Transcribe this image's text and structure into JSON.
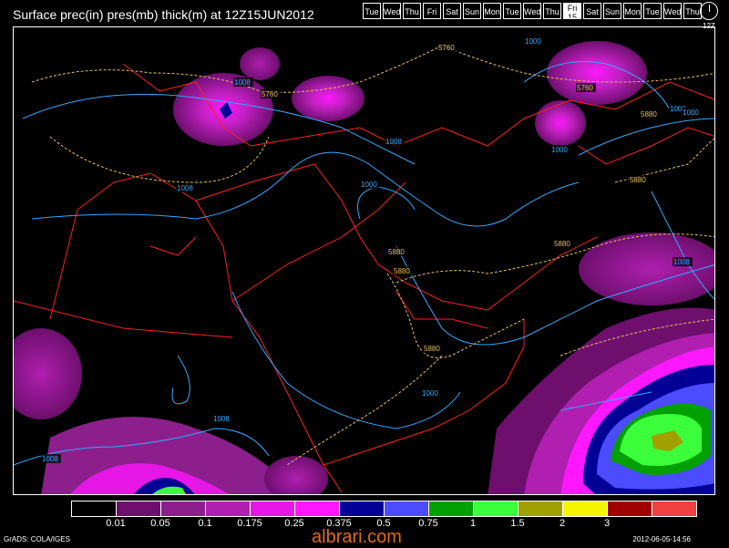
{
  "header": {
    "title": "Surface prec(in) pres(mb) thick(m) at 12Z15JUN2012",
    "days": [
      {
        "label": "Tue"
      },
      {
        "label": "Wed"
      },
      {
        "label": "Thu"
      },
      {
        "label": "Fri"
      },
      {
        "label": "Sat"
      },
      {
        "label": "Sun"
      },
      {
        "label": "Mon"
      },
      {
        "label": "Tue"
      },
      {
        "label": "Wed"
      },
      {
        "label": "Thu"
      },
      {
        "label": "Fri",
        "date": "15"
      },
      {
        "label": "Sat"
      },
      {
        "label": "Sun"
      },
      {
        "label": "Mon"
      },
      {
        "label": "Tue"
      },
      {
        "label": "Wed"
      },
      {
        "label": "Thu"
      }
    ],
    "active_day_index": 10,
    "clock_label": "12Z"
  },
  "map": {
    "isobar_labels": [
      "1008",
      "1008",
      "1000",
      "1008",
      "1000",
      "1000",
      "1008",
      "1008",
      "1000",
      "1000",
      "1000",
      "1008"
    ],
    "thickness_labels": [
      "5760",
      "5760",
      "5760",
      "5880",
      "5880",
      "5880",
      "5880",
      "5880",
      "5880"
    ]
  },
  "legend": {
    "colors": [
      "#000000",
      "#6e0f6e",
      "#8c1f8c",
      "#b01fb0",
      "#e617e6",
      "#ff17ff",
      "#000096",
      "#4b4bff",
      "#00a000",
      "#3cff3c",
      "#a0a000",
      "#f5f500",
      "#a00000",
      "#f04040"
    ],
    "labels": [
      "0.01",
      "0.05",
      "0.1",
      "0.175",
      "0.25",
      "0.375",
      "0.5",
      "0.75",
      "1",
      "1.5",
      "2",
      "3"
    ]
  },
  "footer": {
    "left": "GrADS: COLA/IGES",
    "right": "2012-06-05-14:56",
    "brand": "albrari.com"
  }
}
